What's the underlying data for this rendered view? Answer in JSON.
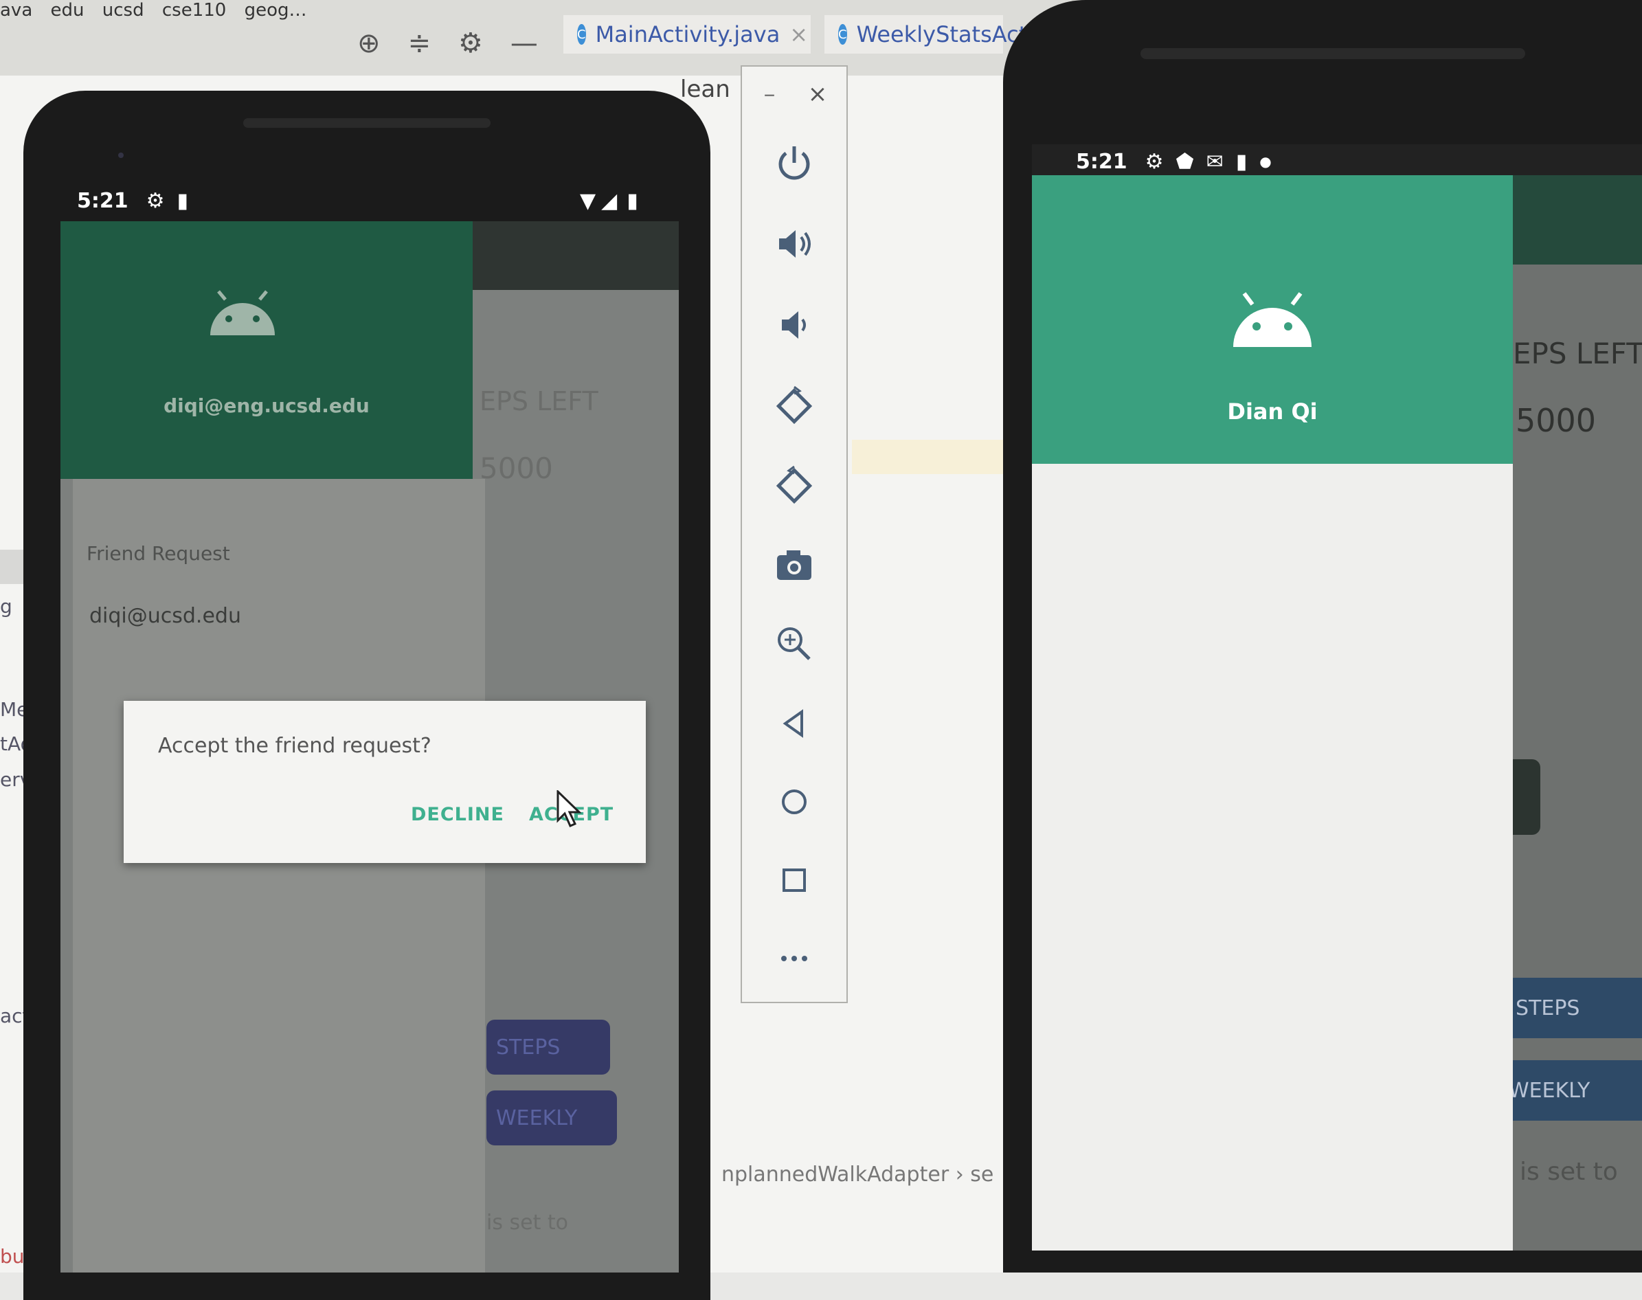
{
  "ide": {
    "breadcrumb": [
      "ava",
      "edu",
      "ucsd",
      "cse110",
      "geog…"
    ],
    "tabs": [
      {
        "label": "MainActivity.java",
        "close": "×"
      },
      {
        "label": "WeeklyStatsAct"
      }
    ],
    "editor_fragment": "lean",
    "left_labels": [
      "g",
      "Messa",
      "tAdap",
      "ervice",
      "actory",
      "buggabl"
    ],
    "bottom_crumb": "nplannedWalkAdapter  ›  se",
    "toolbar_icons": [
      "crosshair-icon",
      "collapse-icon",
      "gear-icon",
      "minimize-icon"
    ]
  },
  "phone1": {
    "status": {
      "time": "5:21"
    },
    "drawer": {
      "email": "diqi@eng.ucsd.edu",
      "section_title": "Friend Request",
      "request_item": "diqi@ucsd.edu"
    },
    "behind": {
      "steps_left": "EPS LEFT",
      "goal": "5000",
      "steps_button": "STEPS",
      "weekly_button": "WEEKLY",
      "set_to": "is set to"
    },
    "dialog": {
      "message": "Accept the friend request?",
      "decline": "DECLINE",
      "accept": "ACCEPT"
    }
  },
  "emulator_panel": {
    "controls": [
      "minimize",
      "close",
      "power",
      "volume-up",
      "volume-down",
      "rotate-left",
      "rotate-right",
      "screenshot",
      "zoom",
      "back",
      "home",
      "overview",
      "more"
    ],
    "minimize_label": "–",
    "close_label": "×"
  },
  "phone2": {
    "status": {
      "time": "5:21"
    },
    "drawer": {
      "name": "Dian Qi"
    },
    "behind": {
      "steps_left": "EPS LEFT",
      "goal": "5000",
      "steps_button": "STEPS",
      "weekly_button": "WEEKLY",
      "set_to": "is set to"
    }
  },
  "colors": {
    "drawer_dark": "#1f5a43",
    "drawer_green": "#3aa07f",
    "dialog_button": "#3fb08f",
    "navy_button": "#363a66"
  }
}
